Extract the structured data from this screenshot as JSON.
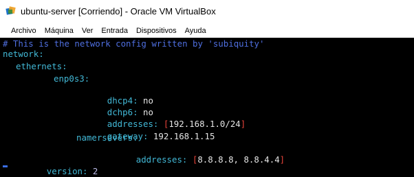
{
  "window": {
    "title": "ubuntu-server [Corriendo] - Oracle VM VirtualBox",
    "icon": "virtualbox-icon"
  },
  "menu": [
    "Archivo",
    "Máquina",
    "Ver",
    "Entrada",
    "Dispositivos",
    "Ayuda"
  ],
  "console": {
    "comment": "# This is the network config written by 'subiquity'",
    "network_key": "network:",
    "ethernets_key": "ethernets:",
    "interface_key": "enp0s3:",
    "dhcp4": {
      "key": "dhcp4:",
      "value": "no"
    },
    "dhcp6": {
      "key": "dchp6:",
      "value": "no"
    },
    "addresses": {
      "key": "addresses:",
      "open": "[",
      "value": "192.168.1.0/24",
      "close": "]"
    },
    "gateway": {
      "key": "gateway:",
      "value": "192.168.1.15"
    },
    "nameservers_key": "namersevers:",
    "dns_addresses": {
      "key": "addresses:",
      "open": "[",
      "value": "8.8.8.8, 8.8.4.4",
      "close": "]"
    },
    "version": {
      "key": "version:",
      "value": "2"
    }
  },
  "colors": {
    "console_bg": "#000000",
    "key": "#42b8d6",
    "value": "#e6e6e6",
    "bracket": "#e8433a",
    "comment": "#4f6fe0"
  }
}
